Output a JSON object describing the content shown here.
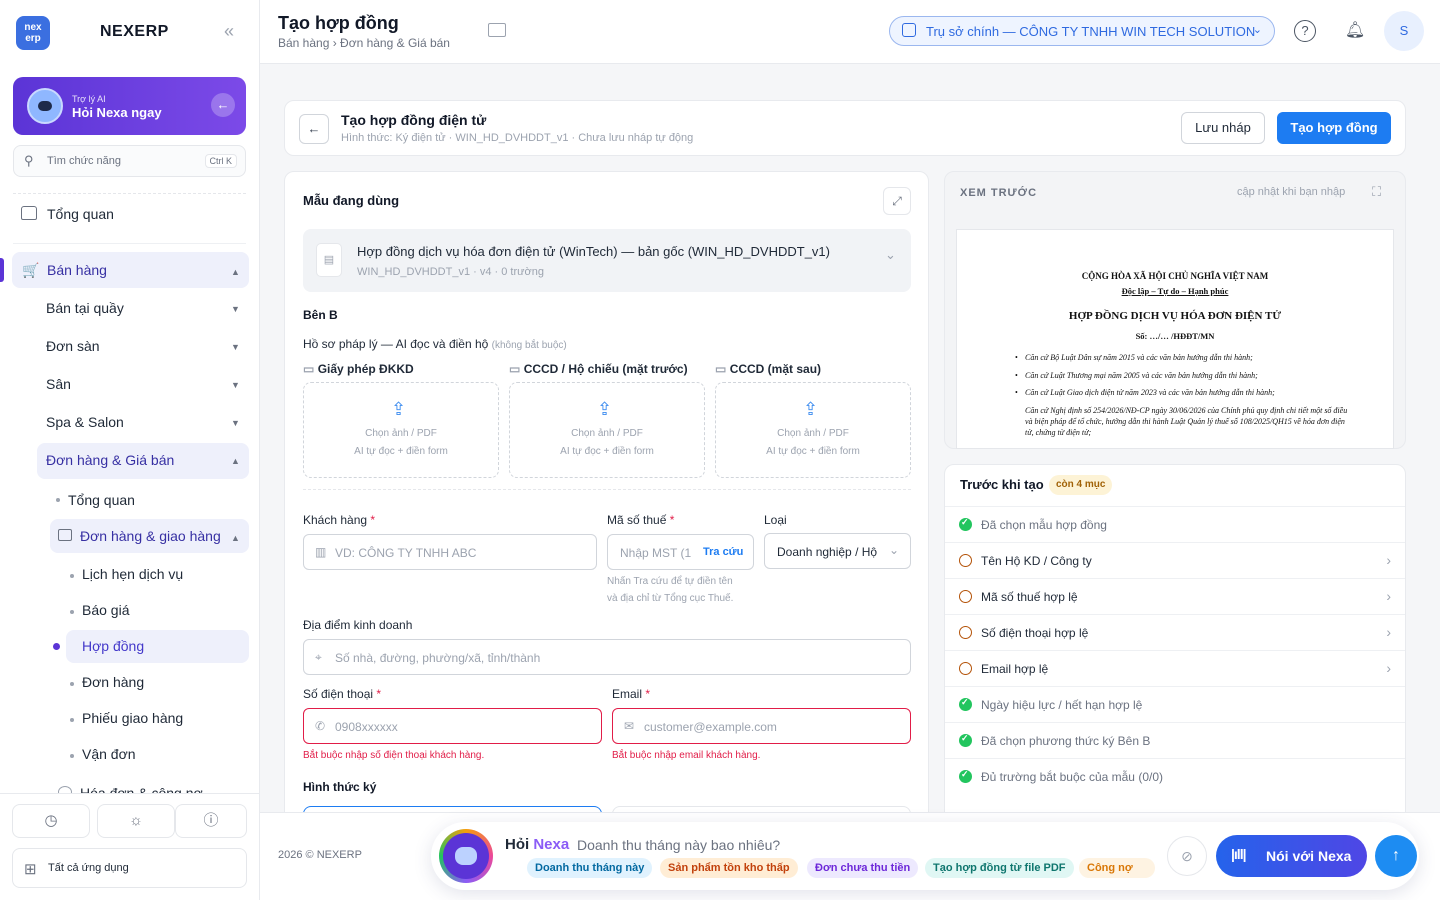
{
  "sidebar": {
    "logo_text": "nex erp",
    "brand": "NEXERP",
    "collapse_icon": "«",
    "ai": {
      "small": "Trợ lý AI",
      "big": "Hỏi Nexa ngay"
    },
    "search": {
      "placeholder": "Tìm chức năng",
      "shortcut": "Ctrl K"
    },
    "overview": "Tổng quan",
    "sales": "Bán hàng",
    "items": [
      "Bán tại quầy",
      "Đơn sàn",
      "Sân",
      "Spa & Salon",
      "Đơn hàng & Giá bán"
    ],
    "sub_overview": "Tổng quan",
    "sub_group": "Đơn hàng & giao hàng",
    "leaf_items": [
      "Lịch hẹn dịch vụ",
      "Báo giá",
      "Hợp đồng",
      "Đơn hàng",
      "Phiếu giao hàng",
      "Vận đơn"
    ],
    "cut_item": "Hóa đơn & công nợ",
    "all_apps": "Tất cả ứng dụng"
  },
  "header": {
    "title": "Tạo hợp đồng",
    "breadcrumb": "Bán hàng › Đơn hàng & Giá bán",
    "branch": "Trụ sở chính — CÔNG TY TNHH WIN TECH SOLUTION",
    "avatar": "S"
  },
  "toolbar": {
    "title": "Tạo hợp đồng điện tử",
    "subtitle": "Hình thức: Ký điện tử · WIN_HD_DVHDDT_v1 · Chưa lưu nháp tự động",
    "save_draft": "Lưu nháp",
    "create": "Tạo hợp đồng"
  },
  "form": {
    "template_heading": "Mẫu đang dùng",
    "template_name": "Hợp đồng dịch vụ hóa đơn điện tử (WinTech) — bản gốc (WIN_HD_DVHDDT_v1)",
    "template_meta": "WIN_HD_DVHDDT_v1 · v4 · 0 trường",
    "party_b": "Bên B",
    "legal_title": "Hồ sơ pháp lý — AI đọc và điền hộ",
    "legal_optional": "(không bắt buộc)",
    "uploads": [
      {
        "label": "Giấy phép ĐKKD",
        "line1": "Chọn ảnh / PDF",
        "line2": "AI tự đọc + điền form"
      },
      {
        "label": "CCCD / Hộ chiếu (mặt trước)",
        "line1": "Chọn ảnh / PDF",
        "line2": "AI tự đọc + điền form"
      },
      {
        "label": "CCCD (mặt sau)",
        "line1": "Chọn ảnh / PDF",
        "line2": "AI tự đọc + điền form"
      }
    ],
    "customer_label": "Khách hàng",
    "customer_placeholder": "VD: CÔNG TY TNHH ABC",
    "tax_label": "Mã số thuế",
    "tax_placeholder": "Nhập MST (1",
    "tax_lookup": "Tra cứu",
    "tax_hint_1": "Nhấn Tra cứu để tự điền tên",
    "tax_hint_2": "và địa chỉ từ Tổng cục Thuế.",
    "type_label": "Loại",
    "type_value": "Doanh nghiệp / Hộ",
    "address_label": "Địa điểm kinh doanh",
    "address_placeholder": "Số nhà, đường, phường/xã, tỉnh/thành",
    "phone_label": "Số điện thoại",
    "phone_placeholder": "0908xxxxxx",
    "phone_error": "Bắt buộc nhập số điện thoại khách hàng.",
    "email_label": "Email",
    "email_placeholder": "customer@example.com",
    "email_error": "Bắt buộc nhập email khách hàng.",
    "sign_method": "Hình thức ký"
  },
  "preview": {
    "title": "XEM TRƯỚC",
    "hint": "cập nhật khi bạn nhập",
    "doc": {
      "nation": "CỘNG HÒA XÃ HỘI CHỦ NGHĨA VIỆT NAM",
      "motto": "Độc lập – Tự do – Hạnh phúc",
      "title": "HỢP ĐỒNG DỊCH VỤ HÓA ĐƠN ĐIỆN TỬ",
      "number": "Số: …/… /HĐĐT/MN",
      "bullets": [
        "Căn cứ Bộ Luật Dân sự năm 2015 và các văn bản hướng dẫn thi hành;",
        "Căn cứ Luật Thương mại năm 2005 và các văn bản hướng dẫn thi hành;",
        "Căn cứ Luật Giao dịch điện tử năm 2023 và các văn bản hướng dẫn thi hành;",
        "Căn cứ Nghị định số 254/2026/NĐ-CP ngày 30/06/2026 của Chính phủ quy định chi tiết một số điều và biện pháp để tổ chức, hướng dẫn thi hành Luật Quản lý thuế số 108/2025/QH15 về hóa đơn điện tử, chứng từ điện tử;"
      ]
    }
  },
  "checklist": {
    "title": "Trước khi tạo",
    "badge": "còn 4 mục",
    "items": [
      {
        "text": "Đã chọn mẫu hợp đồng",
        "done": true
      },
      {
        "text": "Tên Hộ KD / Công ty",
        "done": false
      },
      {
        "text": "Mã số thuế hợp lệ",
        "done": false
      },
      {
        "text": "Số điện thoại hợp lệ",
        "done": false
      },
      {
        "text": "Email hợp lệ",
        "done": false
      },
      {
        "text": "Ngày hiệu lực / hết hạn hợp lệ",
        "done": true
      },
      {
        "text": "Đã chọn phương thức ký Bên B",
        "done": true
      },
      {
        "text": "Đủ trường bắt buộc của mẫu (0/0)",
        "done": true
      }
    ]
  },
  "footer": {
    "copyright": "2026 © NEXERP",
    "ask_prefix": "Hỏi",
    "ask_brand": "Nexa",
    "ask_question": "Doanh thu tháng này bao nhiêu?",
    "chips": [
      "Doanh thu tháng này",
      "Sản phẩm tồn kho thấp",
      "Đơn chưa thu tiền",
      "Tạo hợp đồng từ file PDF",
      "Công nợ quá hạn"
    ],
    "talk_button": "Nói với Nexa"
  },
  "colors": {
    "primary": "#1d7cf2",
    "ai_purple": "#5b34d6",
    "error": "#e11d48",
    "success": "#22c55e"
  }
}
